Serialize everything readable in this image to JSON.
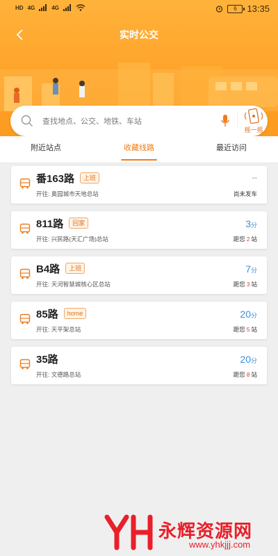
{
  "status_bar": {
    "sim1": "HD",
    "sim2": "HD",
    "net1": "4G",
    "net2": "4G",
    "battery": "6",
    "time": "13:35"
  },
  "header": {
    "title": "实时公交",
    "back_icon": "chevron-left-icon"
  },
  "search": {
    "placeholder": "查找地点、公交、地铁、车站",
    "shake_label": "摇一摇"
  },
  "tabs": [
    {
      "label": "附近站点",
      "active": false
    },
    {
      "label": "收藏线路",
      "active": true
    },
    {
      "label": "最近访问",
      "active": false
    }
  ],
  "routes": [
    {
      "name": "番163路",
      "tag": "上班",
      "dest_prefix": "开往:",
      "destination": "奥园城市天地总站",
      "eta": "--",
      "eta_unit": "",
      "status": "尚未发车"
    },
    {
      "name": "811路",
      "tag": "回家",
      "dest_prefix": "开往:",
      "destination": "兴民路(天汇广场)总站",
      "eta": "3",
      "eta_unit": "分",
      "dist_prefix": "距您",
      "stops": "2",
      "dist_suffix": "站"
    },
    {
      "name": "B4路",
      "tag": "上班",
      "dest_prefix": "开往:",
      "destination": "天河智慧城核心区总站",
      "eta": "7",
      "eta_unit": "分",
      "dist_prefix": "距您",
      "stops": "3",
      "dist_suffix": "站"
    },
    {
      "name": "85路",
      "tag": "home",
      "dest_prefix": "开往:",
      "destination": "天平架总站",
      "eta": "20",
      "eta_unit": "分",
      "dist_prefix": "距您",
      "stops": "5",
      "dist_suffix": "站"
    },
    {
      "name": "35路",
      "tag": "",
      "dest_prefix": "开往:",
      "destination": "文德路总站",
      "eta": "20",
      "eta_unit": "分",
      "dist_prefix": "距您",
      "stops": "8",
      "dist_suffix": "站"
    }
  ],
  "watermark": {
    "logo": "YH",
    "name": "永辉资源网",
    "url": "www.yhkjjj.com"
  },
  "colors": {
    "accent": "#f07b1a",
    "header": "#ffa229",
    "eta": "#3d8fd8",
    "stops": "#e0403a"
  }
}
